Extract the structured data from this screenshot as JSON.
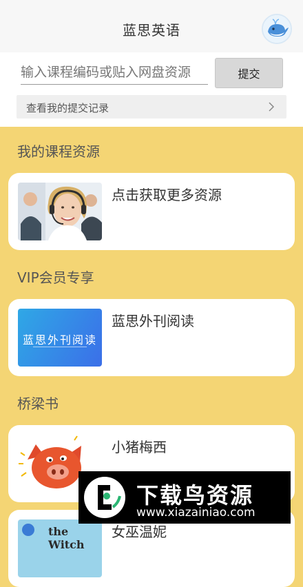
{
  "header": {
    "title": "蓝思英语"
  },
  "search": {
    "placeholder": "输入课程编码或贴入网盘资源",
    "submit_label": "提交",
    "history_label": "查看我的提交记录"
  },
  "sections": [
    {
      "title": "我的课程资源",
      "card_title": "点击获取更多资源"
    },
    {
      "title": "VIP会员专享",
      "card_title": "蓝思外刊阅读",
      "thumb_text": "蓝思外刊阅读"
    },
    {
      "title": "桥梁书",
      "card_title": "小猪梅西"
    }
  ],
  "partial_card": {
    "title": "女巫温妮",
    "thumb_text": "the Witch"
  },
  "watermark": {
    "main": "下载鸟资源",
    "url": "www.xiazainiao.com"
  },
  "colors": {
    "background": "#f4d574",
    "card": "#ffffff",
    "header": "#f7f7f7",
    "button": "#d8d8d8"
  }
}
